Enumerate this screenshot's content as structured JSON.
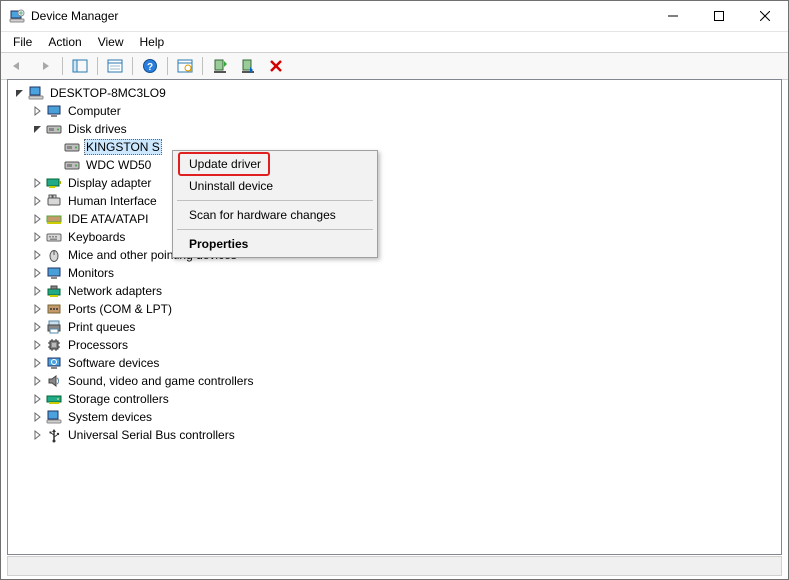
{
  "title": "Device Manager",
  "window_controls": {
    "min": "minimize",
    "max": "maximize",
    "close": "close"
  },
  "menu": {
    "file": "File",
    "action": "Action",
    "view": "View",
    "help": "Help"
  },
  "toolbar_icons": {
    "back": "back-arrow",
    "forward": "forward-arrow",
    "show_hidden": "show-hidden",
    "properties": "properties",
    "help": "help",
    "scan": "scan-hardware",
    "update": "update-driver",
    "uninstall": "uninstall-device",
    "disable": "disable-device"
  },
  "root": {
    "label": "DESKTOP-8MC3LO9",
    "icon": "computer-root-icon",
    "expanded": true
  },
  "nodes": [
    {
      "label": "Computer",
      "icon": "monitor-icon",
      "expander": ">"
    },
    {
      "label": "Disk drives",
      "icon": "disk-icon",
      "expander": "v",
      "children": [
        {
          "label": "KINGSTON S",
          "icon": "disk-icon",
          "selected": true
        },
        {
          "label": "WDC WD50",
          "icon": "disk-icon"
        }
      ]
    },
    {
      "label": "Display adapter",
      "icon": "display-adapter-icon",
      "expander": ">"
    },
    {
      "label": "Human Interface",
      "icon": "hid-icon",
      "expander": ">"
    },
    {
      "label": "IDE ATA/ATAPI",
      "icon": "ide-icon",
      "expander": ">"
    },
    {
      "label": "Keyboards",
      "icon": "keyboard-icon",
      "expander": ">"
    },
    {
      "label": "Mice and other pointing devices",
      "icon": "mouse-icon",
      "expander": ">"
    },
    {
      "label": "Monitors",
      "icon": "monitor-icon",
      "expander": ">"
    },
    {
      "label": "Network adapters",
      "icon": "network-icon",
      "expander": ">"
    },
    {
      "label": "Ports (COM & LPT)",
      "icon": "ports-icon",
      "expander": ">"
    },
    {
      "label": "Print queues",
      "icon": "printer-icon",
      "expander": ">"
    },
    {
      "label": "Processors",
      "icon": "cpu-icon",
      "expander": ">"
    },
    {
      "label": "Software devices",
      "icon": "software-icon",
      "expander": ">"
    },
    {
      "label": "Sound, video and game controllers",
      "icon": "sound-icon",
      "expander": ">"
    },
    {
      "label": "Storage controllers",
      "icon": "storage-icon",
      "expander": ">"
    },
    {
      "label": "System devices",
      "icon": "system-icon",
      "expander": ">"
    },
    {
      "label": "Universal Serial Bus controllers",
      "icon": "usb-icon",
      "expander": ">"
    }
  ],
  "context_menu": {
    "update": "Update driver",
    "uninstall": "Uninstall device",
    "scan": "Scan for hardware changes",
    "properties": "Properties"
  }
}
